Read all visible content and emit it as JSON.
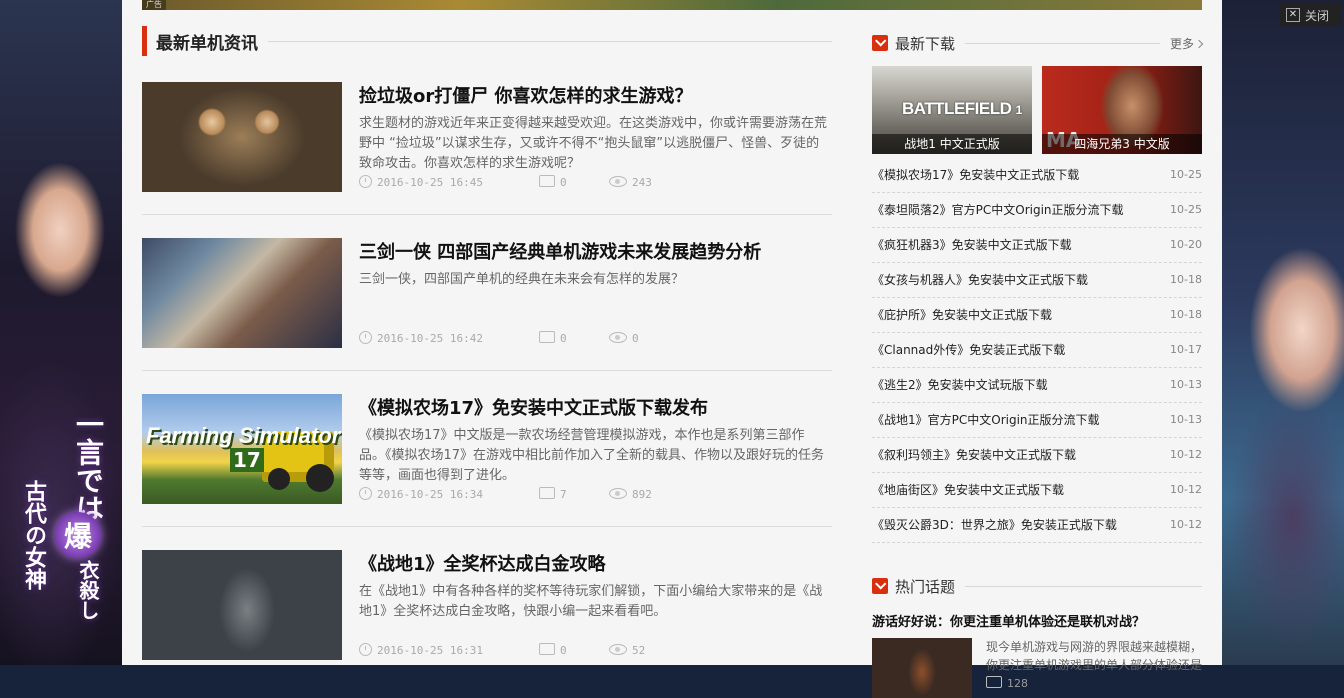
{
  "ad": {
    "tag": "广告",
    "close_label": "关闭"
  },
  "left_poster": {
    "headline": "一言では",
    "badge": "爆",
    "tail": "衣殺し",
    "subline": "古代の女神"
  },
  "main": {
    "section_title": "最新单机资讯",
    "articles": [
      {
        "title": "捡垃圾or打僵尸 你喜欢怎样的求生游戏？",
        "desc": "求生题材的游戏近年来正变得越来越受欢迎。在这类游戏中，你或许需要游荡在荒野中 “捡垃圾”以谋求生存，又或许不得不“抱头鼠窜”以逃脱僵尸、怪兽、歹徒的致命攻击。你喜欢怎样的求生游戏呢？",
        "time": "2016-10-25 16:45",
        "comments": "0",
        "views": "243"
      },
      {
        "title": "三剑一侠 四部国产经典单机游戏未来发展趋势分析",
        "desc": "三剑一侠，四部国产单机的经典在未来会有怎样的发展？",
        "time": "2016-10-25 16:42",
        "comments": "0",
        "views": "0"
      },
      {
        "title": "《模拟农场17》免安装中文正式版下载发布",
        "desc": "《模拟农场17》中文版是一款农场经营管理模拟游戏，本作也是系列第三部作品。《模拟农场17》在游戏中相比前作加入了全新的载具、作物以及跟好玩的任务等等，画面也得到了进化。",
        "time": "2016-10-25 16:34",
        "comments": "7",
        "views": "892",
        "thumb_logo": "Farming Simulator",
        "thumb_num": "17"
      },
      {
        "title": "《战地1》全奖杯达成白金攻略",
        "desc": "在《战地1》中有各种各样的奖杯等待玩家们解锁，下面小编给大家带来的是《战地1》全奖杯达成白金攻略，快跟小编一起来看看吧。",
        "time": "2016-10-25 16:31",
        "comments": "0",
        "views": "52"
      }
    ]
  },
  "sidebar": {
    "downloads_title": "最新下载",
    "more_label": "更多",
    "featured": [
      {
        "caption": "战地1 中文正式版",
        "logo": "BATTLEFIELD",
        "logo_num": "1"
      },
      {
        "caption": "四海兄弟3 中文版",
        "logo": "MA"
      }
    ],
    "download_list": [
      {
        "name": "《模拟农场17》免安装中文正式版下载",
        "date": "10-25"
      },
      {
        "name": "《泰坦陨落2》官方PC中文Origin正版分流下载",
        "date": "10-25"
      },
      {
        "name": "《疯狂机器3》免安装中文正式版下载",
        "date": "10-20"
      },
      {
        "name": "《女孩与机器人》免安装中文正式版下载",
        "date": "10-18"
      },
      {
        "name": "《庇护所》免安装中文正式版下载",
        "date": "10-18"
      },
      {
        "name": "《Clannad外传》免安装正式版下载",
        "date": "10-17"
      },
      {
        "name": "《逃生2》免安装中文试玩版下载",
        "date": "10-13"
      },
      {
        "name": "《战地1》官方PC中文Origin正版分流下载",
        "date": "10-13"
      },
      {
        "name": "《叙利玛领主》免安装中文正式版下载",
        "date": "10-12"
      },
      {
        "name": "《地庙街区》免安装中文正式版下载",
        "date": "10-12"
      },
      {
        "name": "《毁灭公爵3D：世界之旅》免安装正式版下载",
        "date": "10-12"
      }
    ],
    "topics_title": "热门话题",
    "topic": {
      "title": "游话好好说：你更注重单机体验还是联机对战？",
      "desc": "现今单机游戏与网游的界限越来越模糊，你更注重单机游戏里的单人部分体验还是",
      "comments": "128"
    }
  }
}
